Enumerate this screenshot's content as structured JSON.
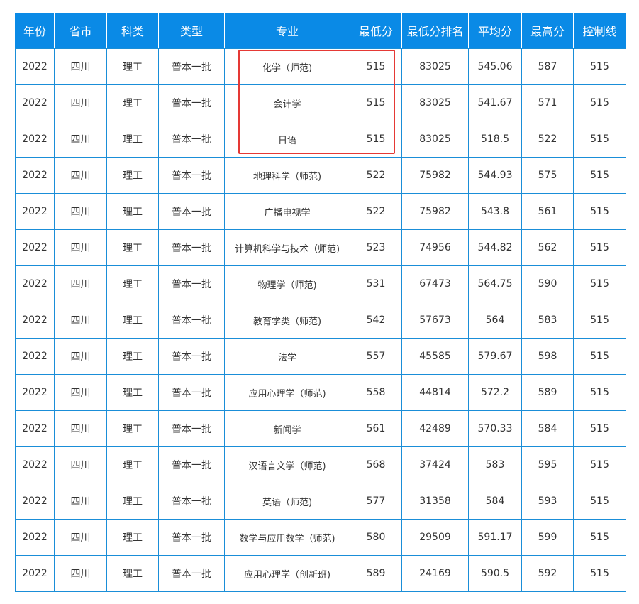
{
  "table": {
    "headers": [
      "年份",
      "省市",
      "科类",
      "类型",
      "专业",
      "最低分",
      "最低分排名",
      "平均分",
      "最高分",
      "控制线"
    ],
    "rows": [
      [
        "2022",
        "四川",
        "理工",
        "普本一批",
        "化学（师范)",
        "515",
        "83025",
        "545.06",
        "587",
        "515"
      ],
      [
        "2022",
        "四川",
        "理工",
        "普本一批",
        "会计学",
        "515",
        "83025",
        "541.67",
        "571",
        "515"
      ],
      [
        "2022",
        "四川",
        "理工",
        "普本一批",
        "日语",
        "515",
        "83025",
        "518.5",
        "522",
        "515"
      ],
      [
        "2022",
        "四川",
        "理工",
        "普本一批",
        "地理科学（师范)",
        "522",
        "75982",
        "544.93",
        "575",
        "515"
      ],
      [
        "2022",
        "四川",
        "理工",
        "普本一批",
        "广播电视学",
        "522",
        "75982",
        "543.8",
        "561",
        "515"
      ],
      [
        "2022",
        "四川",
        "理工",
        "普本一批",
        "计算机科学与技术（师范)",
        "523",
        "74956",
        "544.82",
        "562",
        "515"
      ],
      [
        "2022",
        "四川",
        "理工",
        "普本一批",
        "物理学（师范)",
        "531",
        "67473",
        "564.75",
        "590",
        "515"
      ],
      [
        "2022",
        "四川",
        "理工",
        "普本一批",
        "教育学类（师范)",
        "542",
        "57673",
        "564",
        "583",
        "515"
      ],
      [
        "2022",
        "四川",
        "理工",
        "普本一批",
        "法学",
        "557",
        "45585",
        "579.67",
        "598",
        "515"
      ],
      [
        "2022",
        "四川",
        "理工",
        "普本一批",
        "应用心理学（师范)",
        "558",
        "44814",
        "572.2",
        "589",
        "515"
      ],
      [
        "2022",
        "四川",
        "理工",
        "普本一批",
        "新闻学",
        "561",
        "42489",
        "570.33",
        "584",
        "515"
      ],
      [
        "2022",
        "四川",
        "理工",
        "普本一批",
        "汉语言文学（师范)",
        "568",
        "37424",
        "583",
        "595",
        "515"
      ],
      [
        "2022",
        "四川",
        "理工",
        "普本一批",
        "英语（师范)",
        "577",
        "31358",
        "584",
        "593",
        "515"
      ],
      [
        "2022",
        "四川",
        "理工",
        "普本一批",
        "数学与应用数学（师范)",
        "580",
        "29509",
        "591.17",
        "599",
        "515"
      ],
      [
        "2022",
        "四川",
        "理工",
        "普本一批",
        "应用心理学（创新班)",
        "589",
        "24169",
        "590.5",
        "592",
        "515"
      ]
    ]
  },
  "colors": {
    "header_bg": "#0a8ae6",
    "grid_line": "#1a8ed8",
    "highlight": "#e53935"
  }
}
